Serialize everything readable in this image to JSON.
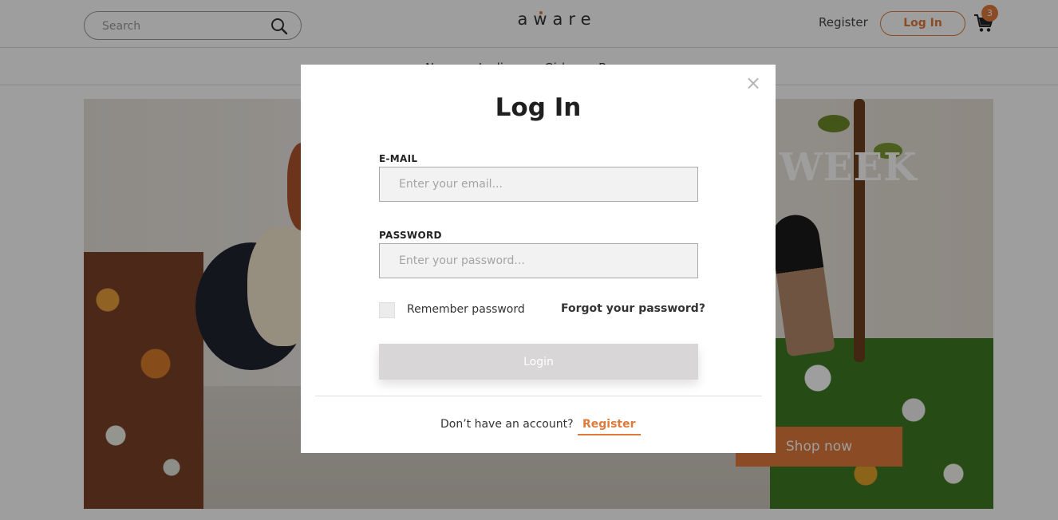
{
  "header": {
    "search_placeholder": "Search",
    "logo": "aware",
    "register_label": "Register",
    "login_label": "Log In",
    "cart_count": "3",
    "nav_items": [
      "New",
      "Ladies",
      "Girls",
      "Boys"
    ]
  },
  "hero": {
    "title": "WEEK",
    "shop_button": "Shop now"
  },
  "modal": {
    "title": "Log In",
    "email_label": "E-MAIL",
    "email_placeholder": "Enter your email...",
    "email_value": "",
    "password_label": "PASSWORD",
    "password_placeholder": "Enter your password...",
    "password_value": "",
    "remember_label": "Remember password",
    "remember_checked": false,
    "forgot_label": "Forgot your password?",
    "submit_label": "Login",
    "footer_text": "Don’t have an account?",
    "footer_register": "Register",
    "close_icon": "close-icon"
  },
  "colors": {
    "accent": "#e07a3a",
    "overlay": "rgba(0,0,0,0.38)"
  }
}
